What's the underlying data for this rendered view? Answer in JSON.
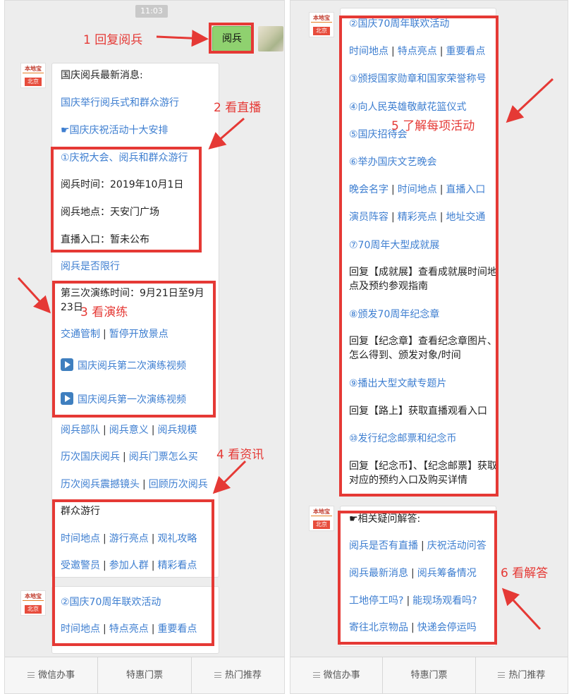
{
  "status_time": "11:03",
  "reply_message": "阅兵",
  "left": {
    "bubble1": {
      "header": "国庆阅兵最新消息:",
      "link1": "国庆举行阅兵式和群众游行",
      "link2": "☛国庆庆祝活动十大安排",
      "item1": "①庆祝大会、阅兵和群众游行",
      "time_line": "阅兵时间：2019年10月1日",
      "place_line": "阅兵地点：天安门广场",
      "live_line": "直播入口：暂未公布",
      "limit_link": "阅兵是否限行",
      "rehearsal_text": "第三次演练时间：9月21日至9月23日",
      "traffic_link": "交通管制",
      "closed_link": "暂停开放景点",
      "video2": "国庆阅兵第二次演练视频",
      "video1": "国庆阅兵第一次演练视频",
      "troops_link": "阅兵部队",
      "meaning_link": "阅兵意义",
      "scale_link": "阅兵规模",
      "history_link": "历次国庆阅兵",
      "tickets_link": "阅兵门票怎么买",
      "shots_link": "历次阅兵震撼镜头",
      "review_link": "回顾历次阅兵",
      "parade_header": "群众游行",
      "parade_time_link": "时间地点",
      "parade_highlight_link": "游行亮点",
      "parade_guide_link": "观礼攻略",
      "guests_link": "受邀警员",
      "join_link": "参加人群",
      "wonderful_link": "精彩看点"
    },
    "bubble2": {
      "item2": "②国庆70周年联欢活动",
      "time_place_link": "时间地点",
      "highlight_link": "特点亮点",
      "key_link": "重要看点"
    }
  },
  "right": {
    "bubble1": {
      "item2": "②国庆70周年联欢活动",
      "time_place_link": "时间地点",
      "highlight_link": "特点亮点",
      "key_link": "重要看点",
      "item3": "③颁授国家勋章和国家荣誉称号",
      "item4": "④向人民英雄敬献花篮仪式",
      "item5": "⑤国庆招待会",
      "item6": "⑥举办国庆文艺晚会",
      "gala_name_link": "晚会名字",
      "gala_time_link": "时间地点",
      "gala_live_link": "直播入口",
      "actors_link": "演员阵容",
      "gala_highlight_link": "精彩亮点",
      "address_link": "地址交通",
      "item7": "⑦70周年大型成就展",
      "item7_desc": "回复【成就展】查看成就展时间地点及预约参观指南",
      "item8": "⑧颁发70周年纪念章",
      "item8_desc": "回复【纪念章】查看纪念章图片、怎么得到、颁发对象/时间",
      "item9": "⑨播出大型文献专题片",
      "item9_desc": "回复【路上】获取直播观看入口",
      "item10": "⑩发行纪念邮票和纪念币",
      "item10_desc": "回复【纪念币】、【纪念邮票】获取对应的预约入口及购买详情"
    },
    "bubble2": {
      "header": "☛相关疑问解答:",
      "live_q_link": "阅兵是否有直播",
      "activity_q_link": "庆祝活动问答",
      "news_link": "阅兵最新消息",
      "prep_link": "阅兵筹备情况",
      "site_q_link": "工地停工吗?",
      "watch_q_link": "能现场观看吗?",
      "mail_q_link": "寄往北京物品",
      "express_q_link": "快递会停运吗"
    }
  },
  "bot_logo": {
    "top": "本地宝",
    "site": "bendibao.com",
    "city": "北京"
  },
  "annotations": {
    "a1": "1 回复阅兵",
    "a2": "2 看直播",
    "a3": "3 看演练",
    "a4": "4 看资讯",
    "a5": "5 了解每项活动",
    "a6": "6 看解答"
  },
  "tabs": [
    "微信办事",
    "特惠门票",
    "热门推荐"
  ],
  "colors": {
    "annotation_red": "#e53935",
    "link_blue": "#3d7ed0",
    "reply_green": "#8fd16f"
  }
}
